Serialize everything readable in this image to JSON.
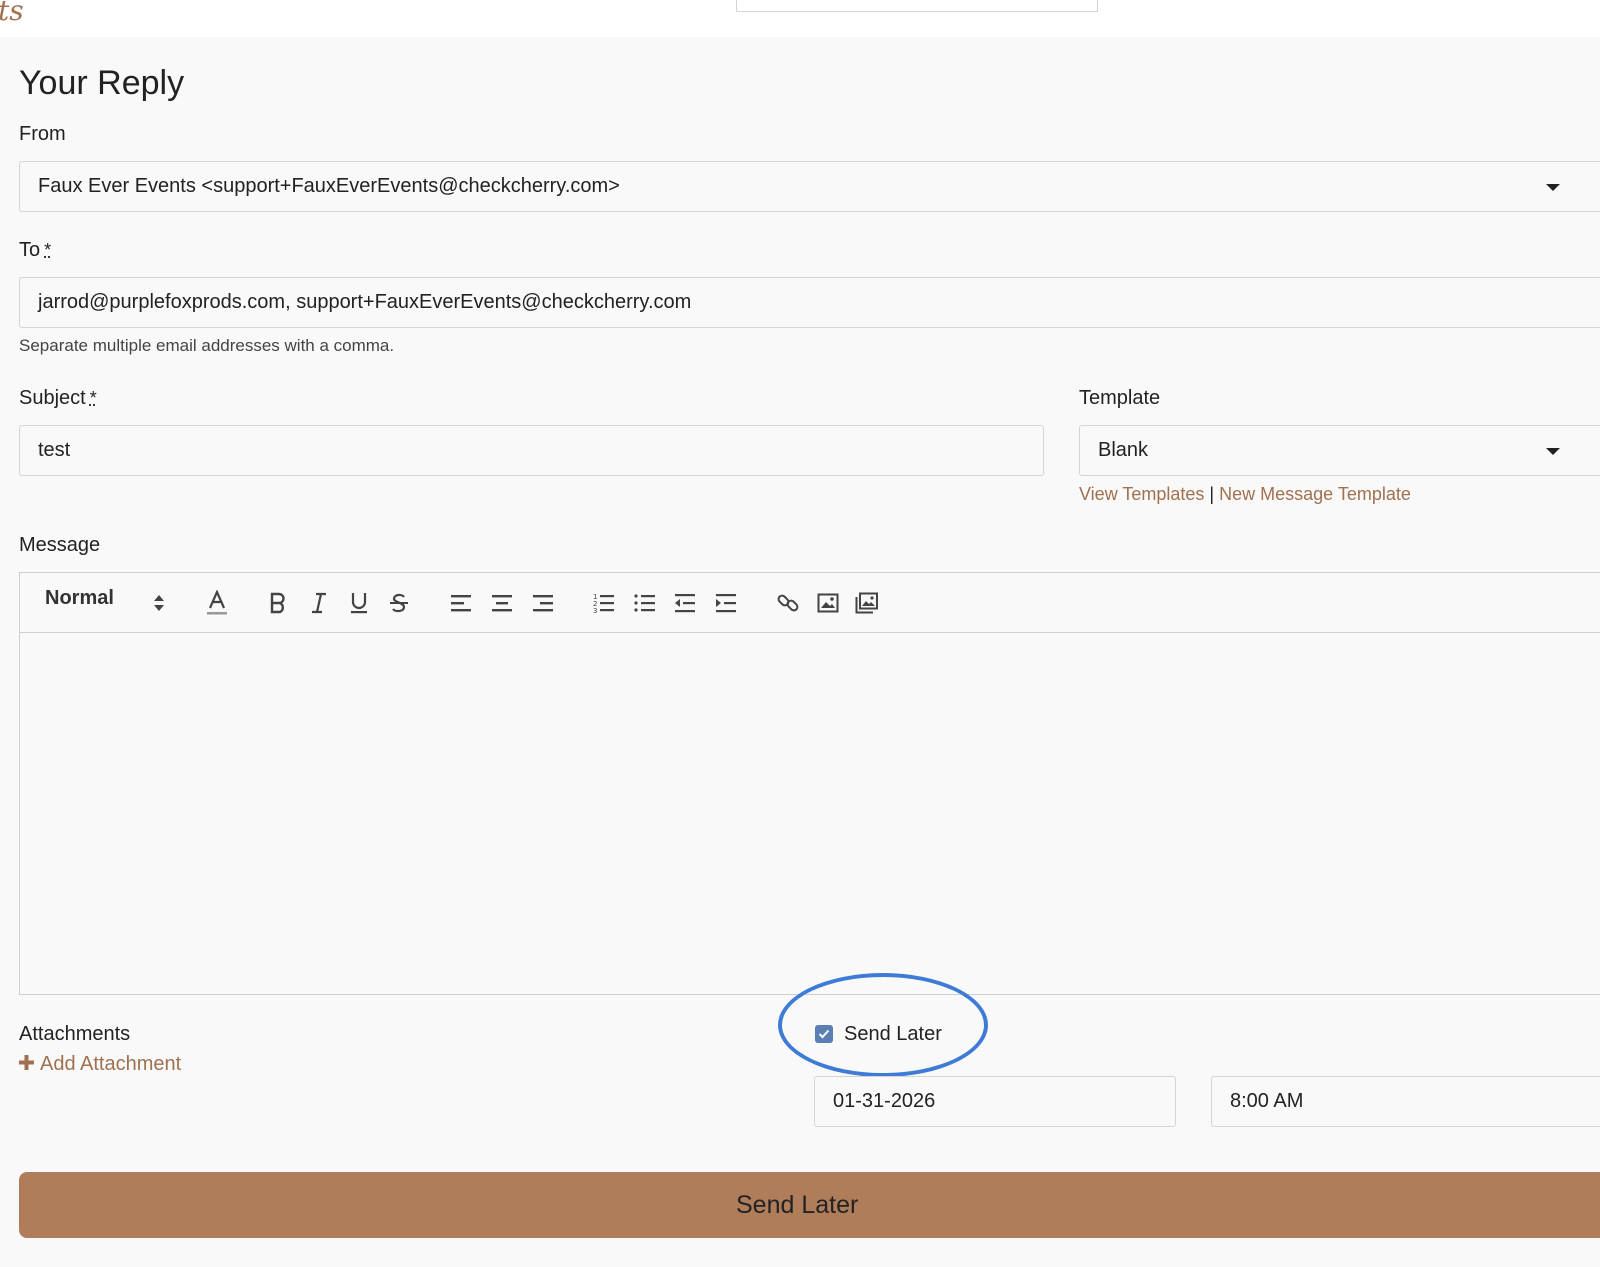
{
  "page": {
    "logo_fragment": "ts",
    "heading": "Your Reply"
  },
  "from": {
    "label": "From",
    "value": "Faux Ever Events <support+FauxEverEvents@checkcherry.com>"
  },
  "to": {
    "label": "To",
    "required_mark": "*",
    "value": "jarrod@purplefoxprods.com, support+FauxEverEvents@checkcherry.com",
    "help": "Separate multiple email addresses with a comma."
  },
  "subject": {
    "label": "Subject",
    "required_mark": "*",
    "value": "test"
  },
  "template": {
    "label": "Template",
    "value": "Blank",
    "view_link": "View Templates",
    "separator": "|",
    "new_link": "New Message Template"
  },
  "message": {
    "label": "Message",
    "style_select": "Normal",
    "toolbar_icons": [
      "text-color-icon",
      "bold-icon",
      "italic-icon",
      "underline-icon",
      "strike-icon",
      "align-left-icon",
      "align-center-icon",
      "align-right-icon",
      "ordered-list-icon",
      "bullet-list-icon",
      "outdent-icon",
      "indent-icon",
      "link-icon",
      "image-icon",
      "gallery-icon"
    ]
  },
  "attachments": {
    "label": "Attachments",
    "add_label": "Add Attachment",
    "add_icon": "plus-icon"
  },
  "schedule": {
    "checkbox_label": "Send Later",
    "checked": true,
    "date": "01-31-2026",
    "time": "8:00 AM"
  },
  "submit": {
    "label": "Send Later"
  },
  "colors": {
    "accent": "#a0714f",
    "button": "#b07d5b",
    "checkbox": "#5a7fb2",
    "highlight": "#3e7bd6"
  }
}
